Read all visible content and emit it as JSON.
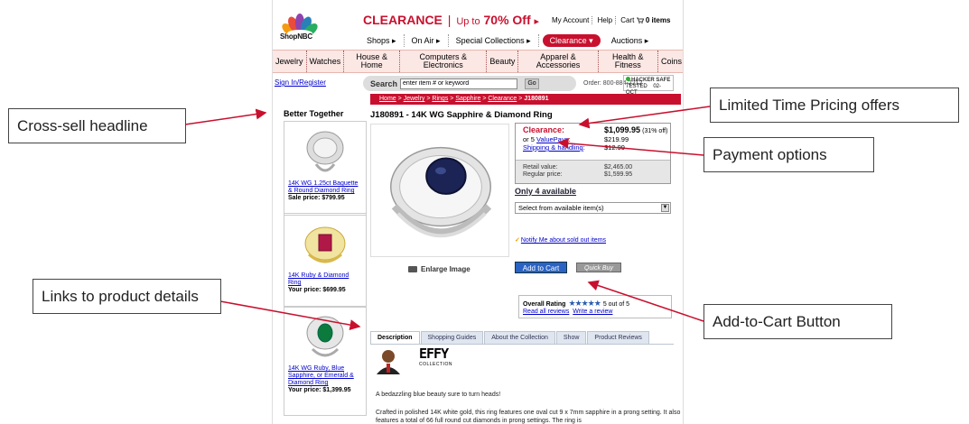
{
  "header": {
    "logo_text": "ShopNBC",
    "promo_clearance": "CLEARANCE",
    "promo_upto": "Up to",
    "promo_off": "70% Off",
    "promo_arrow": "▸",
    "my_account": "My Account",
    "help": "Help",
    "cart": "Cart",
    "cart_count": "0 items"
  },
  "main_nav": [
    {
      "label": "Shops ▸"
    },
    {
      "label": "On Air ▸"
    },
    {
      "label": "Special Collections ▸"
    },
    {
      "label": "Clearance ▾"
    },
    {
      "label": "Auctions ▸"
    }
  ],
  "categories": [
    {
      "label": "Jewelry"
    },
    {
      "label": "Watches"
    },
    {
      "label": "House & Home"
    },
    {
      "label": "Computers & Electronics"
    },
    {
      "label": "Beauty"
    },
    {
      "label": "Apparel & Accessories"
    },
    {
      "label": "Health & Fitness"
    },
    {
      "label": "Coins"
    }
  ],
  "search": {
    "sign_in": "Sign In/Register",
    "label": "Search",
    "value": "enter item # or keyword",
    "go": "Go",
    "order": "Order: 800-884-2212",
    "hacker_safe": "HACKER SAFE",
    "tested": "TESTED",
    "tested_date": "02-OCT"
  },
  "breadcrumb": {
    "items": [
      "Home",
      "Jewelry",
      "Rings",
      "Sapphire",
      "Clearance"
    ],
    "sep": ">",
    "current": "J180891"
  },
  "sidebar": {
    "title": "Better Together",
    "items": [
      {
        "name": "14K WG 1.25ct Baguette & Round Diamond Ring",
        "price": "Sale price: $799.95"
      },
      {
        "name": "14K Ruby & Diamond Ring",
        "price": "Your price: $699.95"
      },
      {
        "name": "14K WG Ruby, Blue Sapphire, or Emerald & Diamond Ring",
        "price": "Your price: $1,399.95"
      }
    ]
  },
  "product": {
    "title": "J180891 - 14K WG Sapphire & Diamond Ring",
    "enlarge": "Enlarge Image",
    "clearance_label": "Clearance:",
    "clearance_price": "$1,099.95",
    "clearance_pct": "(31% off)",
    "valuepays_pre": "or 5",
    "valuepays_link": "ValuePays",
    "valuepays_price": "$219.99",
    "shipping_label": "Shipping & handling",
    "shipping_price": "$12.99",
    "retail_label": "Retail value:",
    "retail_price": "$2,465.00",
    "regular_label": "Regular price:",
    "regular_price": "$1,599.95",
    "availability": "Only 4 available",
    "select_value": "Select from available item(s)",
    "notify": "Notify Me about sold out items",
    "add_to_cart": "Add to Cart",
    "quick_buy": "Quick Buy",
    "rating_label": "Overall Rating",
    "rating_stars": "★★★★★",
    "rating_value": 5,
    "rating_text": "5 out of 5",
    "read_reviews": "Read all reviews",
    "write_review": "Write a review"
  },
  "tabs": [
    {
      "label": "Description"
    },
    {
      "label": "Shopping Guides"
    },
    {
      "label": "About the Collection"
    },
    {
      "label": "Show"
    },
    {
      "label": "Product Reviews"
    }
  ],
  "description": {
    "brand_logo": "EFFY",
    "brand_sub": "COLLECTION",
    "line1": "A bedazzling blue beauty sure to turn heads!",
    "line2": "Crafted in polished 14K white gold, this ring features one oval cut 9 x 7mm sapphire in a prong setting. It also features a total of 66 full round cut diamonds in prong settings. The ring is"
  },
  "callouts": {
    "cross_sell": "Cross-sell headline",
    "links": "Links to product details",
    "limited_time": "Limited Time Pricing offers",
    "payment": "Payment options",
    "add_to_cart": "Add-to-Cart Button"
  },
  "colors": {
    "brand_red": "#c8102e",
    "button_blue": "#2a63c4",
    "category_bg": "#fbe7e4"
  }
}
